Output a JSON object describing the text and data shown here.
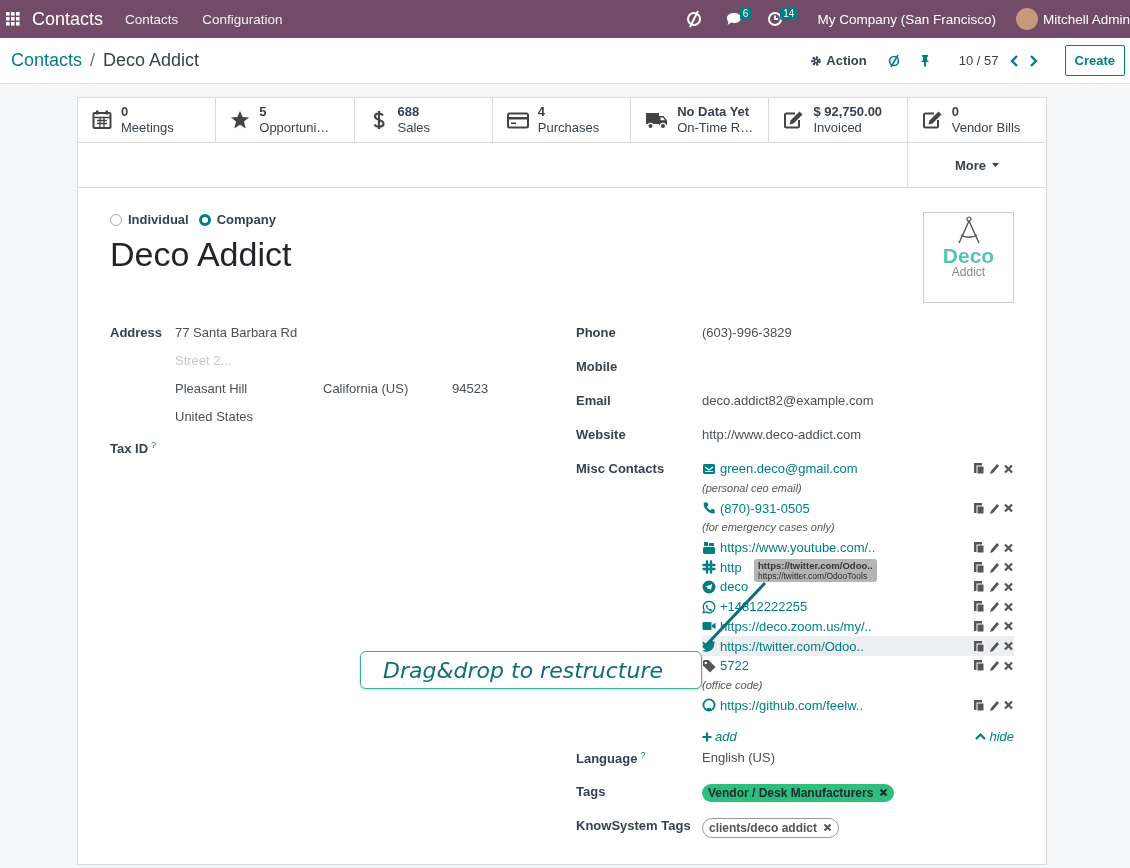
{
  "navbar": {
    "app": "Contacts",
    "menu": [
      "Contacts",
      "Configuration"
    ],
    "messages_badge": "6",
    "activities_badge": "14",
    "company": "My Company (San Francisco)",
    "user": "Mitchell Admin"
  },
  "breadcrumb": {
    "parent": "Contacts",
    "separator": "/",
    "current": "Deco Addict"
  },
  "toolbar": {
    "action": "Action",
    "pager": "10 / 57",
    "create": "Create"
  },
  "smart_buttons": [
    {
      "kind": "calendar",
      "value": "0",
      "label": "Meetings"
    },
    {
      "kind": "star",
      "value": "5",
      "label": "Opportuni…"
    },
    {
      "kind": "dollar",
      "value": "688",
      "label": "Sales"
    },
    {
      "kind": "card",
      "value": "4",
      "label": "Purchases"
    },
    {
      "kind": "truck",
      "value": "No Data Yet",
      "label": "On-Time R…"
    },
    {
      "kind": "edit",
      "value": "$ 92,750.00",
      "label": "Invoiced"
    },
    {
      "kind": "edit",
      "value": "0",
      "label": "Vendor Bills"
    }
  ],
  "more": "More",
  "company_type": [
    {
      "label": "Individual",
      "selected": false
    },
    {
      "label": "Company",
      "selected": true
    }
  ],
  "name": "Deco Addict",
  "logo": {
    "text": "Deco",
    "subtext": "Addict"
  },
  "address": {
    "label": "Address",
    "street": "77 Santa Barbara Rd",
    "street2_placeholder": "Street 2...",
    "city": "Pleasant Hill",
    "state": "California (US)",
    "zip": "94523",
    "country": "United States"
  },
  "tax_id": {
    "label": "Tax ID",
    "help": "?"
  },
  "contact_fields": [
    {
      "label": "Phone",
      "value": "(603)-996-3829"
    },
    {
      "label": "Mobile"
    },
    {
      "label": "Email",
      "value": "deco.addict82@example.com"
    },
    {
      "label": "Website",
      "value": "http://www.deco-addict.com"
    }
  ],
  "misc_contacts": {
    "label": "Misc Contacts",
    "add": "add",
    "hide": "hide",
    "items": [
      {
        "kind": "email",
        "value": "green.deco@gmail.com",
        "note": "(personal ceo email)",
        "hovered": false
      },
      {
        "kind": "phone",
        "value": "(870)-931-0505",
        "note": "(for emergency cases only)",
        "hovered": false
      },
      {
        "kind": "youtube",
        "value": "https://www.youtube.com/..",
        "hovered": false
      },
      {
        "kind": "slack",
        "value": "http",
        "hovered": false
      },
      {
        "kind": "telegram",
        "value": "deco",
        "hovered": false
      },
      {
        "kind": "whatsapp",
        "value": "+14812222255",
        "hovered": false
      },
      {
        "kind": "zoom",
        "value": "https://deco.zoom.us/my/..",
        "hovered": false
      },
      {
        "kind": "twitter",
        "value": "https://twitter.com/Odoo..",
        "hovered": true
      },
      {
        "kind": "tag",
        "value": "5722",
        "note": "(office code)",
        "hovered": false
      },
      {
        "kind": "github",
        "value": "https://github.com/feelw..",
        "hovered": false
      }
    ]
  },
  "language": {
    "label": "Language",
    "help": "?",
    "value": "English (US)"
  },
  "tags": {
    "label": "Tags",
    "items": [
      {
        "label": "Vendor / Desk Manufacturers",
        "color": "#2ebf7f"
      }
    ]
  },
  "knowsystem_tags": {
    "label": "KnowSystem Tags",
    "items": [
      {
        "label": "clients/deco addict"
      }
    ]
  },
  "drag_ghost": {
    "title": "https://twitter.com/Odoo..",
    "url": "https://twitter.com/OdooTools"
  },
  "callout": "Drag&drop to restructure"
}
